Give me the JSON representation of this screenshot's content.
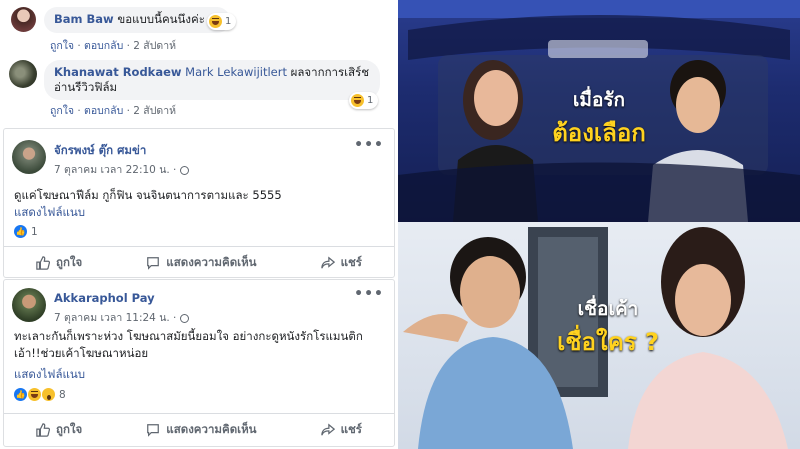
{
  "replies": [
    {
      "name": "Bam Baw",
      "text": "ขอแบบนี้คนนึงค่ะ",
      "reaction_count": "1",
      "like": "ถูกใจ",
      "reply": "ตอบกลับ",
      "time": "2 สัปดาห์"
    },
    {
      "name": "Khanawat Rodkaew",
      "tag": "Mark Lekawijitlert",
      "text_line1": " ผลจากการเสิร์ช",
      "text_line2": "อ่านรีวิวฟิล์ม",
      "reaction_count": "1",
      "like": "ถูกใจ",
      "reply": "ตอบกลับ",
      "time": "2 สัปดาห์"
    }
  ],
  "posts": [
    {
      "name": "จักรพงษ์ ตุ๊ก ศมข่า",
      "time": "7 ตุลาคม เวลา 22:10 น. ·",
      "text": "ดูแค่โฆษณาฟีล์ม กูก็ฟิน จนจินตนาการตามและ 5555",
      "see_more": "แสดงไฟล์แนบ",
      "reaction_count": "1",
      "actions": [
        "ถูกใจ",
        "แสดงความคิดเห็น",
        "แชร์"
      ]
    },
    {
      "name": "Akkaraphol Pay",
      "time": "7 ตุลาคม เวลา 11:24 น. ·",
      "text_line1": "ทะเลาะกันก็เพราะห่วง โฆษณาสมัยนี้ยอมใจ อย่างกะดูหนังรักโรแมนติก",
      "text_line2": "เอ้า!!ช่วยเค้าโฆษณาหน่อย",
      "see_more": "แสดงไฟล์แนบ",
      "reaction_count": "8",
      "actions": [
        "ถูกใจ",
        "แสดงความคิดเห็น",
        "แชร์"
      ]
    }
  ],
  "ad_top": {
    "line1": "เมื่อรัก",
    "line2": "ต้องเลือก"
  },
  "ad_bottom": {
    "line1": "เชื่อเค้า",
    "line2": "เชื่อใคร ?"
  },
  "colors": {
    "link": "#385898",
    "caption_yellow": "#ffd21f",
    "bg_dark": "#1b2a6b"
  }
}
